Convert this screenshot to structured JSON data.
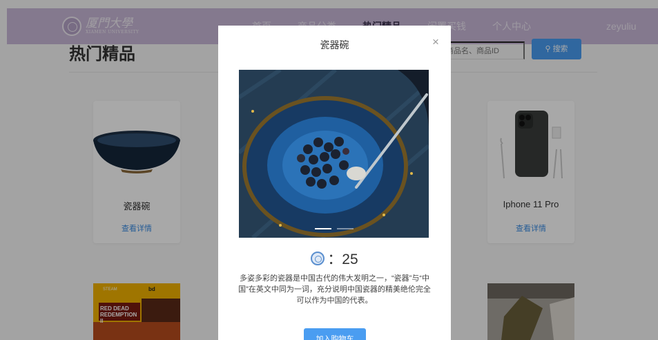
{
  "navbar": {
    "logo_cn": "厦門大學",
    "logo_en": "XIAMEN UNIVERSITY",
    "items": [
      {
        "label": "首页",
        "active": false
      },
      {
        "label": "商品分类",
        "active": false
      },
      {
        "label": "热门精品",
        "active": true
      },
      {
        "label": "闲置买钱",
        "active": false
      },
      {
        "label": "个人中心",
        "active": false
      }
    ],
    "user": "zeyuliu"
  },
  "section": {
    "title": "热门精品",
    "search_placeholder": "商品名、商品ID",
    "search_button": "搜索"
  },
  "cards": [
    {
      "name": "瓷器碗",
      "link": "查看详情"
    },
    {
      "name": "Iphone 11 Pro",
      "link": "查看详情"
    }
  ],
  "bottom_cards": [
    {
      "badges": [
        "STEAM",
        "bd"
      ],
      "game_title": "RED DEAD REDEMPTION II"
    }
  ],
  "modal": {
    "title": "瓷器碗",
    "close": "×",
    "price_label": "：25",
    "description": "多姿多彩的瓷器是中国古代的伟大发明之一，“瓷器”与“中国”在英文中同为一词，充分说明中国瓷器的精美绝伦完全可以作为中国的代表。",
    "cart_button": "加入购物车",
    "carousel_slides": 2,
    "carousel_active": 0
  },
  "colors": {
    "navbar": "#c9b8d8",
    "accent": "#4a9df1",
    "link": "#3b8ee4"
  }
}
